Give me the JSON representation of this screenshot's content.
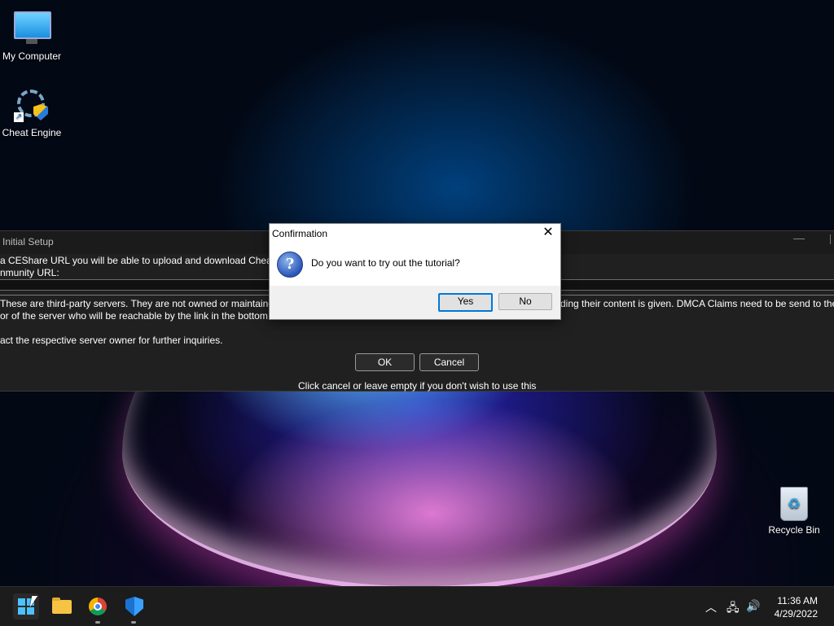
{
  "desktop": {
    "icons": [
      {
        "label": "My Computer",
        "icon": "monitor-icon"
      },
      {
        "label": "Cheat Engine",
        "icon": "cheat-engine-icon"
      },
      {
        "label": "Recycle Bin",
        "icon": "recycle-bin-icon"
      }
    ]
  },
  "setup_window": {
    "title": "Initial Setup",
    "minimize": "—",
    "line1": "a CEShare URL you will be able to upload and download Cheat",
    "line2": "nmunity URL:",
    "info_line1_left": "These are third-party servers. They are not owned or maintained",
    "info_line1_right": "ding their content is given.  DMCA Claims need to be send to the",
    "info_line2": "or of the server who will be reachable by the link in the bottom",
    "info_line3": "act the respective server owner for further inquiries.",
    "ok_label": "OK",
    "cancel_label": "Cancel",
    "hint": "Click cancel or leave empty if you don't wish to use this"
  },
  "confirm_dialog": {
    "title": "Confirmation",
    "close_glyph": "✕",
    "icon_glyph": "?",
    "message": "Do you want to try out the tutorial?",
    "yes_label": "Yes",
    "no_label": "No"
  },
  "taskbar": {
    "apps": [
      "start",
      "file-explorer",
      "chrome",
      "windows-security"
    ],
    "tray": {
      "chevron": "︿",
      "network": "🖧",
      "volume": "🔊"
    },
    "time": "11:36 AM",
    "date": "4/29/2022"
  }
}
